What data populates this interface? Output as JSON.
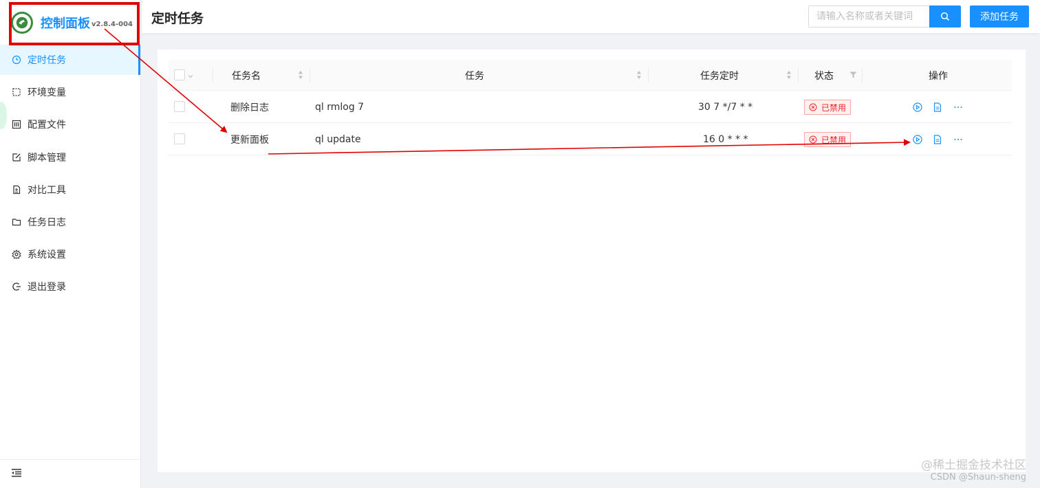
{
  "app": {
    "name": "控制面板",
    "version": "v2.8.4-004"
  },
  "sidebar": {
    "items": [
      {
        "label": "定时任务",
        "icon": "clock-icon",
        "active": true
      },
      {
        "label": "环境变量",
        "icon": "variable-icon"
      },
      {
        "label": "配置文件",
        "icon": "config-icon"
      },
      {
        "label": "脚本管理",
        "icon": "edit-icon"
      },
      {
        "label": "对比工具",
        "icon": "diff-icon"
      },
      {
        "label": "任务日志",
        "icon": "folder-icon"
      },
      {
        "label": "系统设置",
        "icon": "gear-icon"
      },
      {
        "label": "退出登录",
        "icon": "logout-icon"
      }
    ],
    "collapse_icon": "menu-fold-icon"
  },
  "header": {
    "title": "定时任务",
    "search_placeholder": "请输入名称或者关键词",
    "add_label": "添加任务"
  },
  "table": {
    "columns": {
      "name": "任务名",
      "command": "任务",
      "schedule": "任务定时",
      "status": "状态",
      "actions": "操作"
    },
    "rows": [
      {
        "name": "删除日志",
        "command": "ql rmlog 7",
        "schedule": "30 7 */7 * *",
        "status": "已禁用"
      },
      {
        "name": "更新面板",
        "command": "ql update",
        "schedule": "16 0 * * *",
        "status": "已禁用"
      }
    ]
  },
  "colors": {
    "primary": "#1890ff",
    "danger": "#f5222d",
    "annotation": "#e00000"
  },
  "watermark": {
    "line1": "@稀土掘金技术社区",
    "line2": "CSDN @Shaun-sheng"
  }
}
